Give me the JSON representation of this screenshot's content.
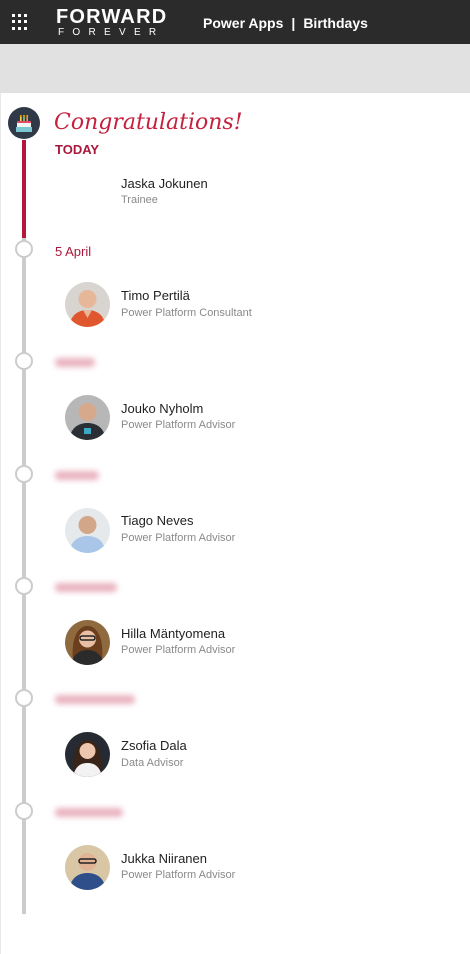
{
  "header": {
    "logo_top": "FORWARD",
    "logo_bottom": "FOREVER",
    "app_name": "Power Apps",
    "separator": "|",
    "app_title": "Birthdays",
    "bg_color": "#2b2b2b"
  },
  "main": {
    "heading": "Congratulations!",
    "accent_color": "#b4163c",
    "today_label": "TODAY",
    "today_person": {
      "name": "Jaska Jokunen",
      "role": "Trainee"
    }
  },
  "timeline": [
    {
      "date": "5 April",
      "blurred": false,
      "name": "Timo Pertilä",
      "role": "Power Platform Consultant",
      "avatar": "avatar-timo"
    },
    {
      "date": "",
      "blurred": true,
      "name": "Jouko Nyholm",
      "role": "Power Platform Advisor",
      "avatar": "avatar-jouko"
    },
    {
      "date": "",
      "blurred": true,
      "name": "Tiago Neves",
      "role": "Power Platform Advisor",
      "avatar": "avatar-tiago"
    },
    {
      "date": "",
      "blurred": true,
      "name": "Hilla Mäntyomena",
      "role": "Power Platform Advisor",
      "avatar": "avatar-hilla"
    },
    {
      "date": "",
      "blurred": true,
      "name": "Zsofia Dala",
      "role": "Data Advisor",
      "avatar": "avatar-zsofia"
    },
    {
      "date": "",
      "blurred": true,
      "name": "Jukka Niiranen",
      "role": "Power Platform Advisor",
      "avatar": "avatar-jukka"
    }
  ]
}
